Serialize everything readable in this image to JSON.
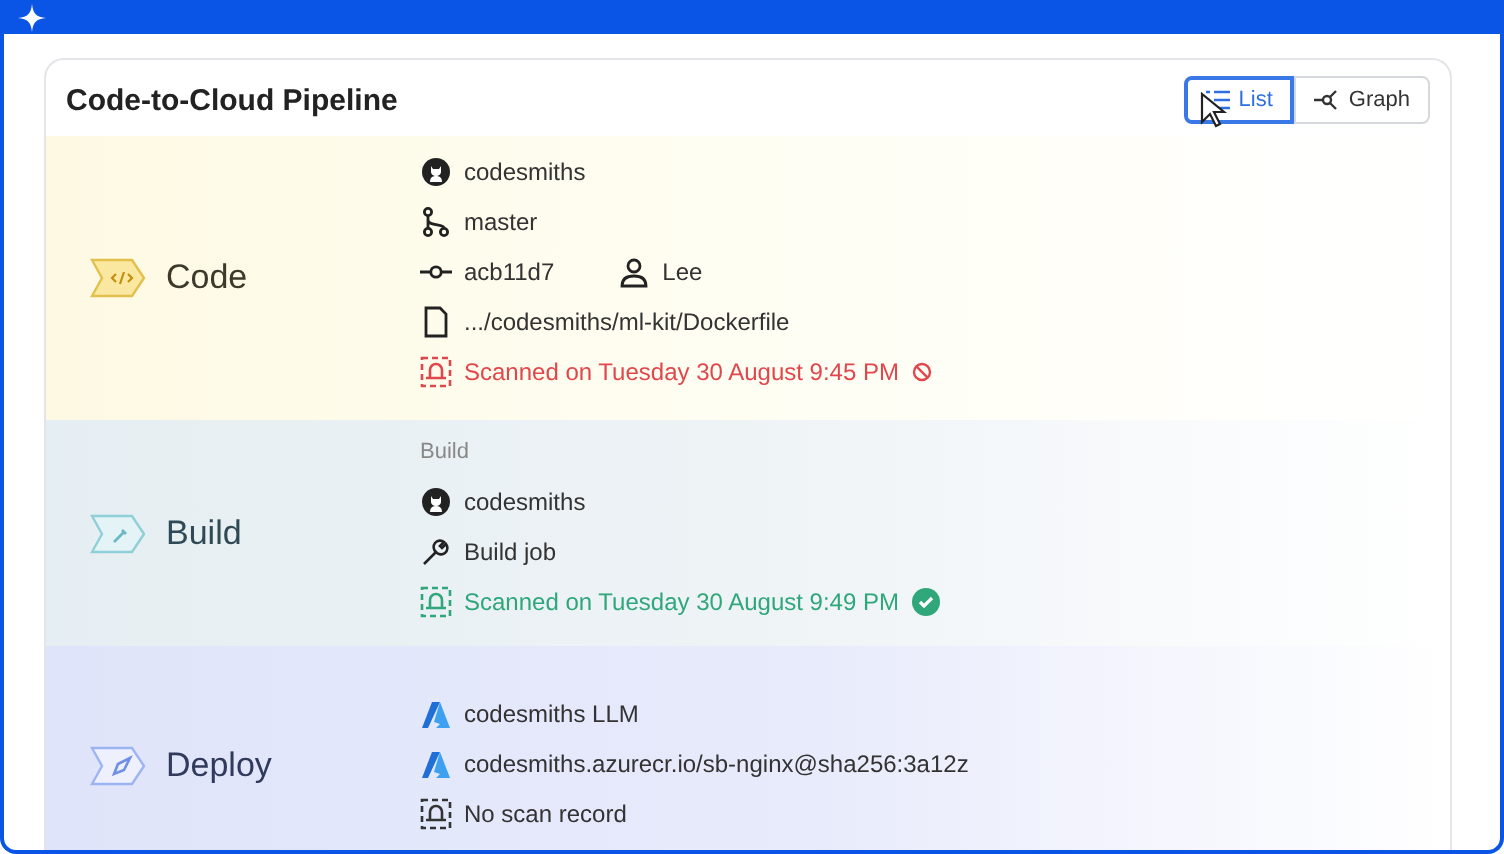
{
  "card": {
    "title": "Code-to-Cloud Pipeline"
  },
  "view_toggle": [
    {
      "label": "List",
      "kind": "list",
      "selected": true
    },
    {
      "label": "Graph",
      "kind": "graph",
      "selected": false
    }
  ],
  "stages": [
    {
      "name": "Code",
      "kind": "code",
      "lines": [
        {
          "kind": "repo",
          "text": "codesmiths"
        },
        {
          "kind": "branch",
          "text": "master"
        },
        {
          "kind": "commit",
          "text": "acb11d7",
          "user": "Lee"
        },
        {
          "kind": "file",
          "text": ".../codesmiths/ml-kit/Dockerfile"
        },
        {
          "kind": "scan_failed",
          "text": "Scanned on Tuesday 30 August 9:45 PM"
        }
      ]
    },
    {
      "name": "Build",
      "kind": "build",
      "lines": [
        {
          "kind": "caption",
          "text": "Build"
        },
        {
          "kind": "repo",
          "text": "codesmiths"
        },
        {
          "kind": "tool",
          "text": "Build job"
        },
        {
          "kind": "scan_passed",
          "text": "Scanned on Tuesday 30 August 9:49 PM"
        }
      ]
    },
    {
      "name": "Deploy",
      "kind": "deploy",
      "lines": [
        {
          "kind": "azure",
          "text": "codesmiths LLM"
        },
        {
          "kind": "azure",
          "text": "codesmiths.azurecr.io/sb-nginx@sha256:3a12z"
        },
        {
          "kind": "scan_none",
          "text": "No scan record"
        }
      ]
    }
  ]
}
